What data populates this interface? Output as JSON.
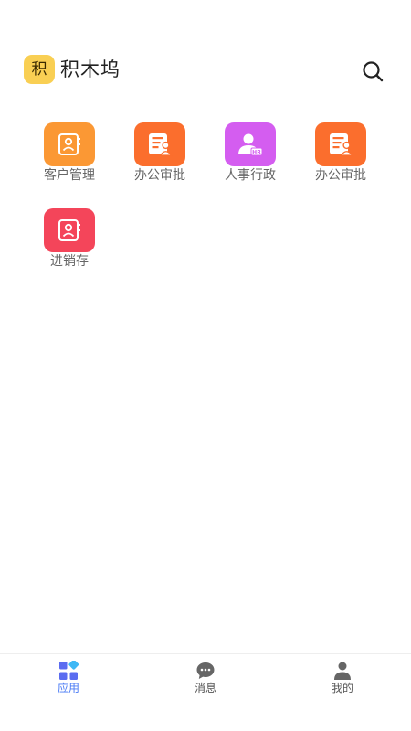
{
  "header": {
    "logo_text": "积",
    "title": "积木坞",
    "search_icon": "search-icon"
  },
  "apps": [
    {
      "label": "客户管理",
      "icon": "contact-book-icon",
      "color": "#fb9834"
    },
    {
      "label": "办公审批",
      "icon": "approval-document-icon",
      "color": "#fb6e2d"
    },
    {
      "label": "人事行政",
      "icon": "hr-person-icon",
      "color": "#d45df0"
    },
    {
      "label": "办公审批",
      "icon": "approval-document-icon",
      "color": "#fb6e2d"
    },
    {
      "label": "进销存",
      "icon": "inventory-book-icon",
      "color": "#f4455a"
    }
  ],
  "bottom_nav": {
    "items": [
      {
        "label": "应用",
        "icon": "apps-grid-icon",
        "active": true
      },
      {
        "label": "消息",
        "icon": "chat-bubble-icon",
        "active": false
      },
      {
        "label": "我的",
        "icon": "profile-icon",
        "active": false
      }
    ],
    "active_color": "#4a7bf5",
    "inactive_color": "#555555"
  }
}
